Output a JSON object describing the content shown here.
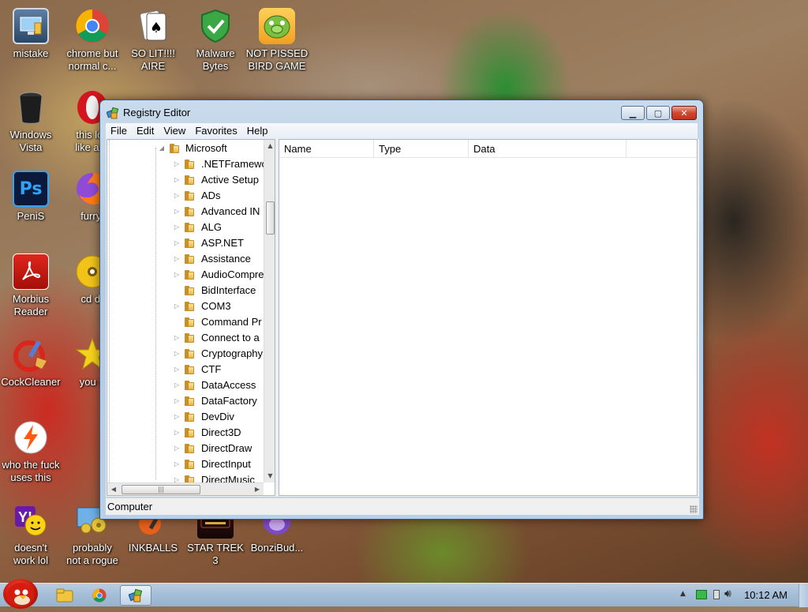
{
  "window": {
    "title": "Registry Editor",
    "menu": [
      "File",
      "Edit",
      "View",
      "Favorites",
      "Help"
    ],
    "tree": {
      "root": "Microsoft",
      "items": [
        ".NETFramewo",
        "Active Setup",
        "ADs",
        "Advanced IN",
        "ALG",
        "ASP.NET",
        "Assistance",
        "AudioCompre",
        "BidInterface",
        "COM3",
        "Command Pr",
        "Connect to a",
        "Cryptography",
        "CTF",
        "DataAccess",
        "DataFactory",
        "DevDiv",
        "Direct3D",
        "DirectDraw",
        "DirectInput",
        "DirectMusic"
      ]
    },
    "list_columns": [
      "Name",
      "Type",
      "Data"
    ],
    "status": "Computer"
  },
  "desktop_icons": [
    {
      "label": "mistake"
    },
    {
      "label": "chrome but\nnormal c..."
    },
    {
      "label": "SO LIT!!!!\nAIRE"
    },
    {
      "label": "Malware\nBytes"
    },
    {
      "label": "NOT PISSED\nBIRD GAME"
    },
    {
      "label": "Windows\nVista"
    },
    {
      "label": "this loo\nlike a vi"
    },
    {
      "label": "PeniS"
    },
    {
      "label": "furryf"
    },
    {
      "label": "Morbius\nReader"
    },
    {
      "label": "cd dr"
    },
    {
      "label": "CockCleaner"
    },
    {
      "label": "you tr"
    },
    {
      "label": "who the fuck\nuses this"
    },
    {
      "label": "doesn't\nwork lol"
    },
    {
      "label": "probably\nnot a rogue"
    },
    {
      "label": "INKBALLS"
    },
    {
      "label": "STAR TREK\n3"
    },
    {
      "label": "BonziBud..."
    }
  ],
  "taskbar": {
    "clock": "10:12 AM"
  },
  "colors": {
    "close_button": "#c23418",
    "titlebar": "#c9dbec",
    "taskbar": "#a6bfd8"
  }
}
